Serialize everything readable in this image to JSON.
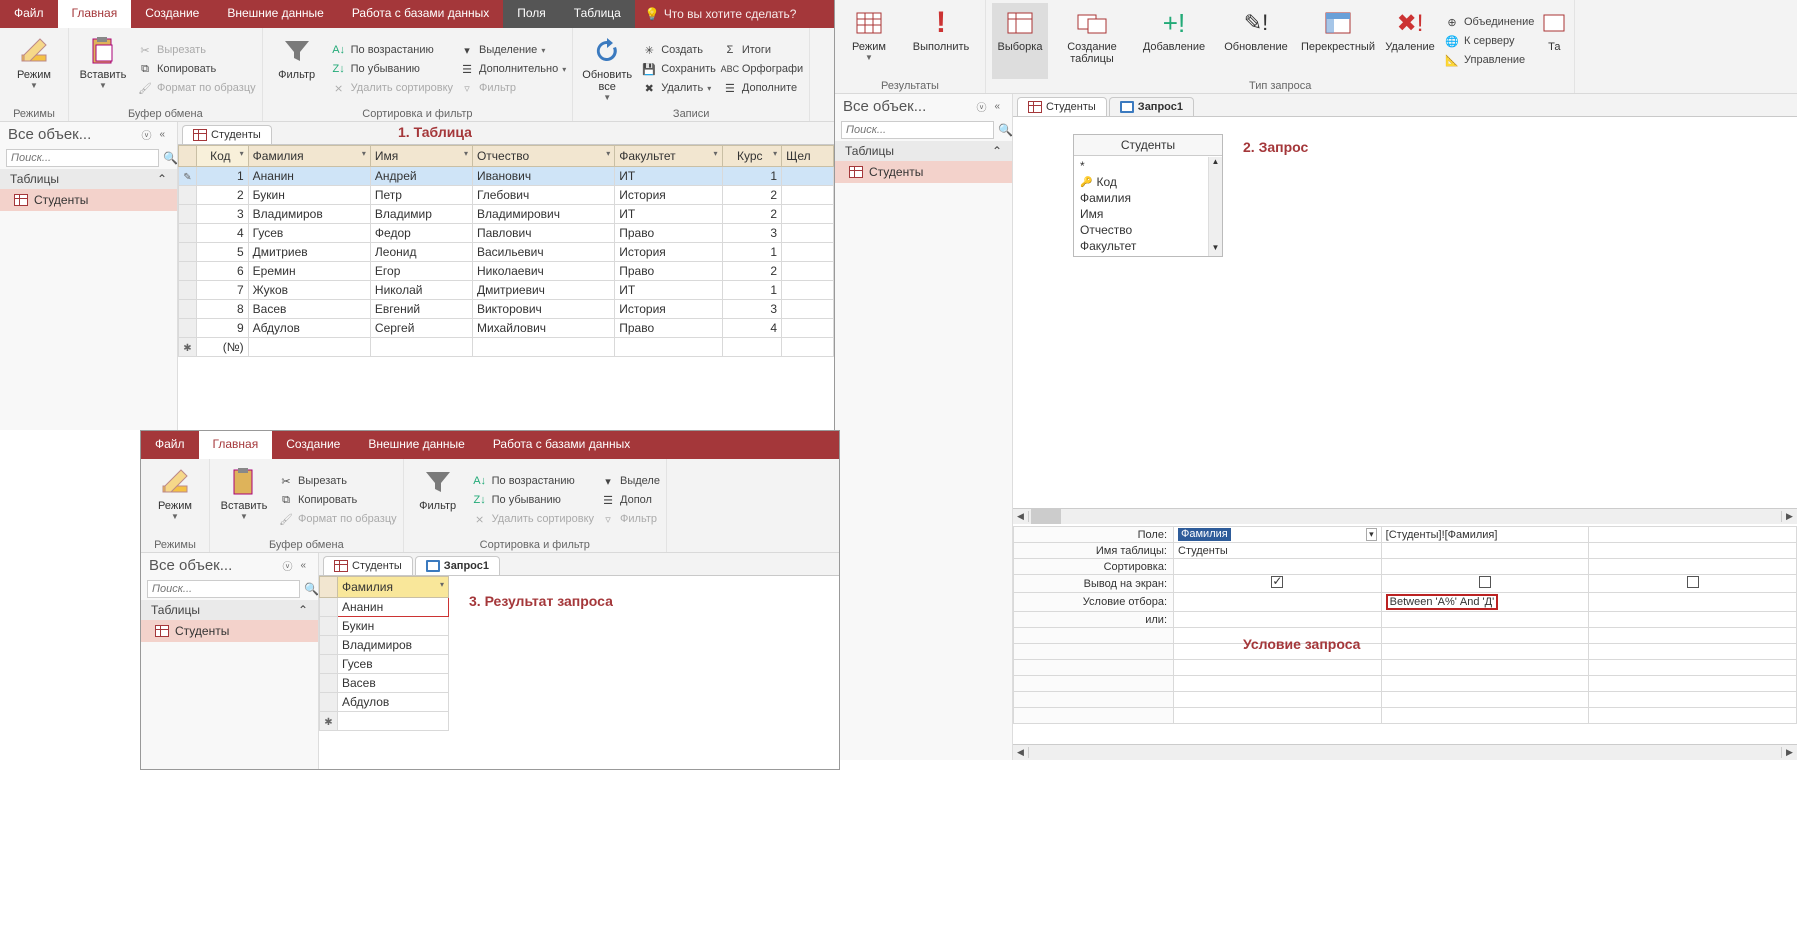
{
  "ribbon1": {
    "tabs": [
      "Файл",
      "Главная",
      "Создание",
      "Внешние данные",
      "Работа с базами данных",
      "Поля",
      "Таблица"
    ],
    "tellMe": "Что вы хотите сделать?",
    "groups": {
      "modes": {
        "mode": "Режим",
        "label": "Режимы"
      },
      "clipboard": {
        "paste": "Вставить",
        "cut": "Вырезать",
        "copy": "Копировать",
        "fmt": "Формат по образцу",
        "label": "Буфер обмена"
      },
      "sort": {
        "filter": "Фильтр",
        "asc": "По возрастанию",
        "desc": "По убыванию",
        "clear": "Удалить сортировку",
        "sel": "Выделение",
        "adv": "Дополнительно",
        "flt": "Фильтр",
        "label": "Сортировка и фильтр"
      },
      "records": {
        "refresh": "Обновить все",
        "new": "Создать",
        "save": "Сохранить",
        "del": "Удалить",
        "sum": "Итоги",
        "spell": "Орфографи",
        "more": "Дополните",
        "label": "Записи"
      }
    },
    "navTitle": "Все объек...",
    "search": "Поиск...",
    "section": "Таблицы",
    "item": "Студенты",
    "tab": "Студенты",
    "cols": [
      "Код",
      "Фамилия",
      "Имя",
      "Отчество",
      "Факультет",
      "Курс",
      "Щел"
    ],
    "rows": [
      {
        "id": 1,
        "f": "Ананин",
        "i": "Андрей",
        "o": "Иванович",
        "fac": "ИТ",
        "k": 1
      },
      {
        "id": 2,
        "f": "Букин",
        "i": "Петр",
        "o": "Глебович",
        "fac": "История",
        "k": 2
      },
      {
        "id": 3,
        "f": "Владимиров",
        "i": "Владимир",
        "o": "Владимирович",
        "fac": "ИТ",
        "k": 2
      },
      {
        "id": 4,
        "f": "Гусев",
        "i": "Федор",
        "o": "Павлович",
        "fac": "Право",
        "k": 3
      },
      {
        "id": 5,
        "f": "Дмитриев",
        "i": "Леонид",
        "o": "Васильевич",
        "fac": "История",
        "k": 1
      },
      {
        "id": 6,
        "f": "Еремин",
        "i": "Егор",
        "o": "Николаевич",
        "fac": "Право",
        "k": 2
      },
      {
        "id": 7,
        "f": "Жуков",
        "i": "Николай",
        "o": "Дмитриевич",
        "fac": "ИТ",
        "k": 1
      },
      {
        "id": 8,
        "f": "Васев",
        "i": "Евгений",
        "o": "Викторович",
        "fac": "История",
        "k": 3
      },
      {
        "id": 9,
        "f": "Абдулов",
        "i": "Сергей",
        "o": "Михайлович",
        "fac": "Право",
        "k": 4
      }
    ],
    "newRow": "(№)"
  },
  "ribbon2": {
    "groups": {
      "results": {
        "mode": "Режим",
        "run": "Выполнить",
        "label": "Результаты"
      },
      "qtype": {
        "select": "Выборка",
        "make": "Создание таблицы",
        "append": "Добавление",
        "update": "Обновление",
        "cross": "Перекрестный",
        "delete": "Удаление",
        "union": "Объединение",
        "server": "К серверу",
        "manage": "Управление",
        "ta": "Та",
        "label": "Тип запроса"
      }
    },
    "navTitle": "Все объек...",
    "search": "Поиск...",
    "section": "Таблицы",
    "item": "Студенты",
    "tabStud": "Студенты",
    "tabQry": "Запрос1",
    "fieldBox": {
      "title": "Студенты",
      "fields": [
        "*",
        "Код",
        "Фамилия",
        "Имя",
        "Отчество",
        "Факультет"
      ]
    },
    "qbe": {
      "labels": {
        "field": "Поле:",
        "table": "Имя таблицы:",
        "sort": "Сортировка:",
        "show": "Вывод на экран:",
        "crit": "Условие отбора:",
        "or": "или:"
      },
      "c1": {
        "field": "Фамилия",
        "table": "Студенты"
      },
      "c2": {
        "field": "[Студенты]![Фамилия]",
        "crit": "Between 'А%' And 'Д'"
      }
    }
  },
  "ribbon3": {
    "tabs": [
      "Файл",
      "Главная",
      "Создание",
      "Внешние данные",
      "Работа с базами данных"
    ],
    "groups": {
      "modes": {
        "mode": "Режим",
        "label": "Режимы"
      },
      "clipboard": {
        "paste": "Вставить",
        "cut": "Вырезать",
        "copy": "Копировать",
        "fmt": "Формат по образцу",
        "label": "Буфер обмена"
      },
      "sort": {
        "filter": "Фильтр",
        "asc": "По возрастанию",
        "desc": "По убыванию",
        "clear": "Удалить сортировку",
        "sel": "Выделе",
        "adv": "Допол",
        "flt": "Фильтр",
        "label": "Сортировка и фильтр"
      }
    },
    "navTitle": "Все объек...",
    "search": "Поиск...",
    "section": "Таблицы",
    "item": "Студенты",
    "tabStud": "Студенты",
    "tabQry": "Запрос1",
    "col": "Фамилия",
    "rows": [
      "Ананин",
      "Букин",
      "Владимиров",
      "Гусев",
      "Васев",
      "Абдулов"
    ]
  },
  "anno": {
    "a1": "1. Таблица",
    "a2": "2. Запрос",
    "a3": "3. Результат запроса",
    "a4": "Условие запроса"
  }
}
